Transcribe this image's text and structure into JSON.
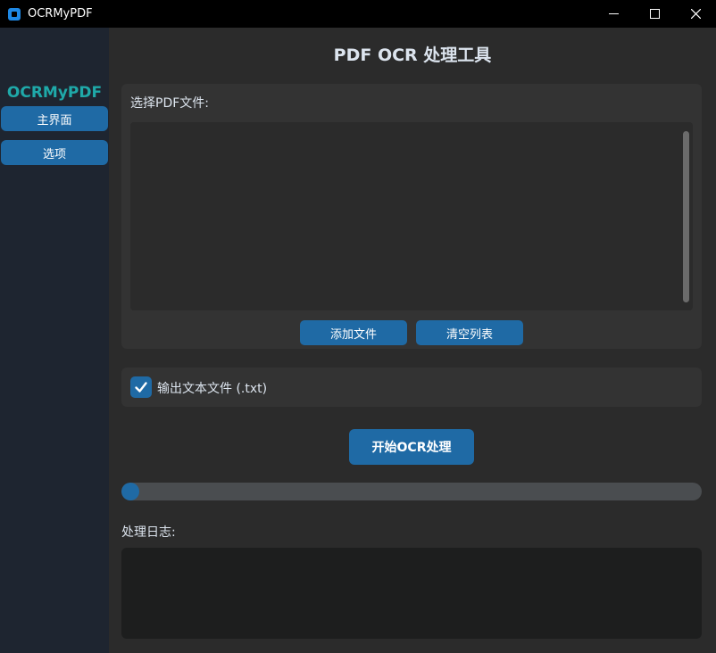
{
  "window": {
    "title": "OCRMyPDF"
  },
  "sidebar": {
    "logo": "OCRMyPDF",
    "items": [
      {
        "label": "主界面"
      },
      {
        "label": "选项"
      }
    ]
  },
  "main": {
    "title": "PDF OCR 处理工具",
    "file_section": {
      "label": "选择PDF文件:",
      "files": [],
      "add_button": "添加文件",
      "clear_button": "清空列表"
    },
    "output_txt": {
      "label": "输出文本文件 (.txt)",
      "checked": true
    },
    "start_button": "开始OCR处理",
    "progress": {
      "value": 0
    },
    "log": {
      "label": "处理日志:",
      "content": ""
    }
  },
  "colors": {
    "accent": "#1f6aa5",
    "logo": "#1fa9a9",
    "background": "#2b2b2b",
    "frame": "#333333",
    "sidebar": "#1e2530"
  },
  "icons": [
    "app-icon",
    "minimize-icon",
    "maximize-icon",
    "close-icon",
    "checkmark-icon"
  ]
}
